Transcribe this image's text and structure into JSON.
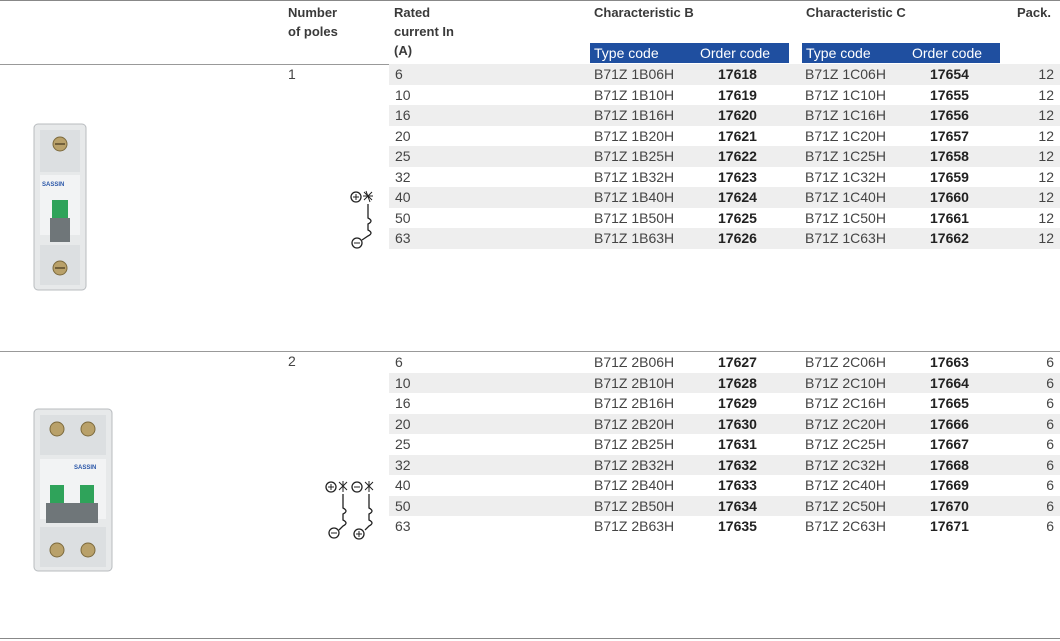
{
  "header": {
    "poles": "Number\nof poles",
    "poles_l1": "Number",
    "poles_l2": "of poles",
    "rated_l1": "Rated",
    "rated_l2": "current In",
    "rated_l3": "(A)",
    "char_b": "Characteristic B",
    "char_c": "Characteristic C",
    "pack": "Pack.",
    "type_code": "Type code",
    "order_code": "Order code"
  },
  "product_brand": "SASSIN",
  "groups": [
    {
      "poles": "1",
      "rows": [
        {
          "current": "6",
          "type_b": "B71Z 1B06H",
          "order_b": "17618",
          "type_c": "B71Z 1C06H",
          "order_c": "17654",
          "pack": "12"
        },
        {
          "current": "10",
          "type_b": "B71Z 1B10H",
          "order_b": "17619",
          "type_c": "B71Z 1C10H",
          "order_c": "17655",
          "pack": "12"
        },
        {
          "current": "16",
          "type_b": "B71Z 1B16H",
          "order_b": "17620",
          "type_c": "B71Z 1C16H",
          "order_c": "17656",
          "pack": "12"
        },
        {
          "current": "20",
          "type_b": "B71Z 1B20H",
          "order_b": "17621",
          "type_c": "B71Z 1C20H",
          "order_c": "17657",
          "pack": "12"
        },
        {
          "current": "25",
          "type_b": "B71Z 1B25H",
          "order_b": "17622",
          "type_c": "B71Z 1C25H",
          "order_c": "17658",
          "pack": "12"
        },
        {
          "current": "32",
          "type_b": "B71Z 1B32H",
          "order_b": "17623",
          "type_c": "B71Z 1C32H",
          "order_c": "17659",
          "pack": "12"
        },
        {
          "current": "40",
          "type_b": "B71Z 1B40H",
          "order_b": "17624",
          "type_c": "B71Z 1C40H",
          "order_c": "17660",
          "pack": "12"
        },
        {
          "current": "50",
          "type_b": "B71Z 1B50H",
          "order_b": "17625",
          "type_c": "B71Z 1C50H",
          "order_c": "17661",
          "pack": "12"
        },
        {
          "current": "63",
          "type_b": "B71Z 1B63H",
          "order_b": "17626",
          "type_c": "B71Z 1C63H",
          "order_c": "17662",
          "pack": "12"
        }
      ]
    },
    {
      "poles": "2",
      "rows": [
        {
          "current": "6",
          "type_b": "B71Z 2B06H",
          "order_b": "17627",
          "type_c": "B71Z 2C06H",
          "order_c": "17663",
          "pack": "6"
        },
        {
          "current": "10",
          "type_b": "B71Z 2B10H",
          "order_b": "17628",
          "type_c": "B71Z 2C10H",
          "order_c": "17664",
          "pack": "6"
        },
        {
          "current": "16",
          "type_b": "B71Z 2B16H",
          "order_b": "17629",
          "type_c": "B71Z 2C16H",
          "order_c": "17665",
          "pack": "6"
        },
        {
          "current": "20",
          "type_b": "B71Z 2B20H",
          "order_b": "17630",
          "type_c": "B71Z 2C20H",
          "order_c": "17666",
          "pack": "6"
        },
        {
          "current": "25",
          "type_b": "B71Z 2B25H",
          "order_b": "17631",
          "type_c": "B71Z 2C25H",
          "order_c": "17667",
          "pack": "6"
        },
        {
          "current": "32",
          "type_b": "B71Z 2B32H",
          "order_b": "17632",
          "type_c": "B71Z 2C32H",
          "order_c": "17668",
          "pack": "6"
        },
        {
          "current": "40",
          "type_b": "B71Z 2B40H",
          "order_b": "17633",
          "type_c": "B71Z 2C40H",
          "order_c": "17669",
          "pack": "6"
        },
        {
          "current": "50",
          "type_b": "B71Z 2B50H",
          "order_b": "17634",
          "type_c": "B71Z 2C50H",
          "order_c": "17670",
          "pack": "6"
        },
        {
          "current": "63",
          "type_b": "B71Z 2B63H",
          "order_b": "17635",
          "type_c": "B71Z 2C63H",
          "order_c": "17671",
          "pack": "6"
        }
      ]
    }
  ],
  "colors": {
    "header_blue": "#1f4fa0",
    "row_shade": "#eeeeee",
    "switch_green": "#2fa35a"
  },
  "icons": [
    "mcb-1-pole-photo",
    "mcb-2-pole-photo",
    "circuit-symbol-1-pole",
    "circuit-symbol-2-pole"
  ]
}
